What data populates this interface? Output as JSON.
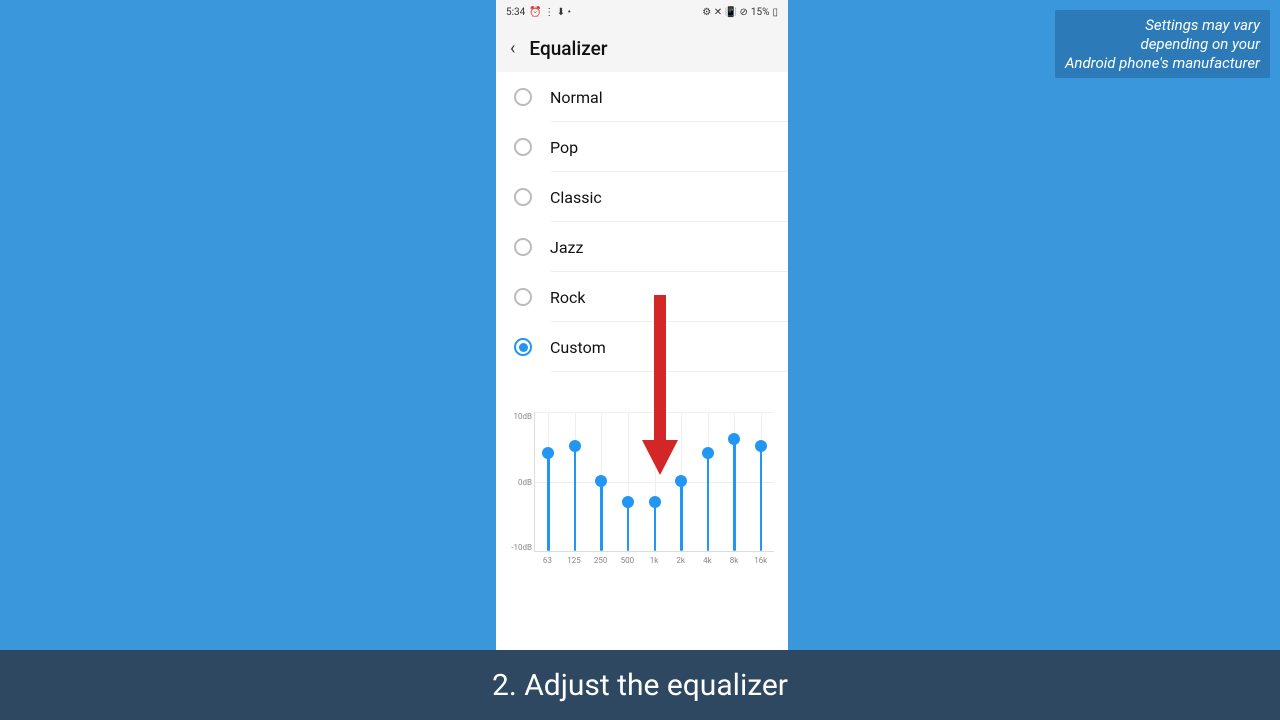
{
  "status": {
    "time": "5:34",
    "left_icons": "⏰ ⋮ ⬇ •",
    "right_icons": "⚙ ✕ 📳 ⊘",
    "battery": "15%"
  },
  "header": {
    "title": "Equalizer"
  },
  "presets": [
    {
      "label": "Normal",
      "selected": false
    },
    {
      "label": "Pop",
      "selected": false
    },
    {
      "label": "Classic",
      "selected": false
    },
    {
      "label": "Jazz",
      "selected": false
    },
    {
      "label": "Rock",
      "selected": false
    },
    {
      "label": "Custom",
      "selected": true
    }
  ],
  "chart_data": {
    "type": "bar",
    "ylabel_top": "10dB",
    "ylabel_mid": "0dB",
    "ylabel_bottom": "-10dB",
    "ylim": [
      -10,
      10
    ],
    "categories": [
      "63",
      "125",
      "250",
      "500",
      "1k",
      "2k",
      "4k",
      "8k",
      "16k"
    ],
    "values": [
      4,
      5,
      0,
      -3,
      -3,
      0,
      4,
      6,
      5
    ]
  },
  "note": {
    "line1": "Settings may vary",
    "line2": "depending on your",
    "line3": "Android phone's manufacturer"
  },
  "caption": "2. Adjust the equalizer"
}
